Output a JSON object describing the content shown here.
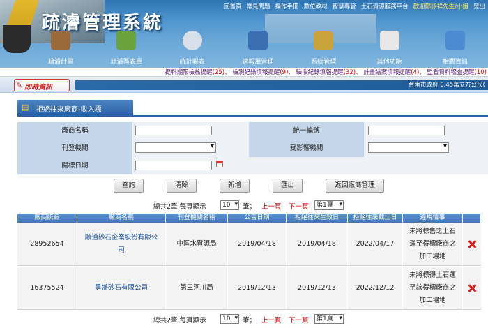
{
  "header": {
    "title": "疏濬管理系統",
    "toplinks": [
      "回首頁",
      "常見問題",
      "操作手冊",
      "數位教材",
      "智慧專管",
      "土石資源服務平台"
    ],
    "welcome": "歡迎鄭詠祥先生/小姐",
    "logout": "登出"
  },
  "menu": [
    {
      "label": "疏濬計畫",
      "icon": "document-icon",
      "color": "#9a6a3a"
    },
    {
      "label": "疏濬區表單",
      "icon": "river-icon",
      "color": "#6aa23b"
    },
    {
      "label": "統計報表",
      "icon": "magnifier-icon",
      "color": "#d7dfe8"
    },
    {
      "label": "速報單管理",
      "icon": "form-icon",
      "color": "#3a6fb3"
    },
    {
      "label": "系統管理",
      "icon": "tools-icon",
      "color": "#c9a43a"
    },
    {
      "label": "其他功能",
      "icon": "notepad-icon",
      "color": "#e7e7e7"
    },
    {
      "label": "相關資訊",
      "icon": "monitor-icon",
      "color": "#4c8ad1"
    }
  ],
  "alerts": [
    {
      "label": "提料期限檢核提醒",
      "count": "(25)"
    },
    {
      "label": "檢測紀錄填報提醒",
      "count": "(9)"
    },
    {
      "label": "驗收紀錄填報提醒",
      "count": "(32)"
    },
    {
      "label": "計畫結案填報提醒",
      "count": "(4)"
    },
    {
      "label": "監看資料稽查提醒",
      "count": "(10)"
    }
  ],
  "news": {
    "tag": "即時資訊",
    "ticker": "台南市政府 0.45萬立方公尺("
  },
  "panel": {
    "title": "拒絕往來廠商-收入標"
  },
  "form": {
    "vendor_name_label": "廠商名稱",
    "vendor_name_value": "",
    "tax_id_label": "統一編號",
    "tax_id_value": "",
    "publish_agency_label": "刊登機關",
    "publish_agency_value": "",
    "affected_agency_label": "受影響機關",
    "affected_agency_value": "",
    "date_label": "關標日期",
    "date_value": ""
  },
  "buttons": {
    "query": "查詢",
    "clear": "清除",
    "add": "新增",
    "export": "匯出",
    "back": "返回廠商管理"
  },
  "pager": {
    "total_prefix": "總共2筆 每頁顯示",
    "page_size": "10",
    "unit": "筆；",
    "prev": "上一頁",
    "next": "下一頁",
    "page": "第1頁"
  },
  "table": {
    "columns": [
      "廠商統編",
      "廠商名稱",
      "刊登機關名稱",
      "公告日期",
      "拒絕往來生效日",
      "拒絕往來截止日",
      "違規情事"
    ],
    "rows": [
      {
        "tax_id": "28952654",
        "name_line1": "順通砂石企業股份有限公",
        "name_line2": "司",
        "agency": "中區水資源局",
        "announce": "2019/04/18",
        "effective": "2019/04/18",
        "expiry": "2022/04/17",
        "violation_line1": "未將標售之土石",
        "violation_line2": "運至得標廠商之",
        "violation_line3": "加工場地"
      },
      {
        "tax_id": "16375524",
        "name_line1": "勇盛砂石有限公司",
        "name_line2": "",
        "agency": "第三河川局",
        "announce": "2019/12/13",
        "effective": "2019/12/13",
        "expiry": "2022/12/12",
        "violation_line1": "未將標得土石運",
        "violation_line2": "至該得標廠商之",
        "violation_line3": "加工場地"
      }
    ]
  }
}
